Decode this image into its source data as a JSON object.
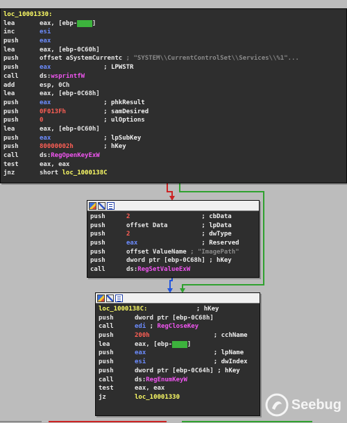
{
  "block1": {
    "lines": [
      {
        "type": "label",
        "text": "loc_10001330:"
      },
      {
        "mn": "lea",
        "parts": [
          {
            "t": "eax, [ebp-",
            "c": "plain"
          },
          {
            "t": "0C8h",
            "c": "hl"
          },
          {
            "t": "]",
            "c": "plain"
          }
        ]
      },
      {
        "mn": "inc",
        "parts": [
          {
            "t": "esi",
            "c": "blue"
          }
        ]
      },
      {
        "mn": "push",
        "parts": [
          {
            "t": "eax",
            "c": "blue"
          }
        ]
      },
      {
        "mn": "lea",
        "parts": [
          {
            "t": "eax, [ebp-0C60h]",
            "c": "plain"
          }
        ]
      },
      {
        "mn": "push",
        "parts": [
          {
            "t": "offset aSystemCurrentc",
            "c": "plain"
          },
          {
            "t": " ; \"SYSTEM\\\\CurrentControlSet\\\\Services\\\\%1\"...",
            "c": "gray"
          }
        ]
      },
      {
        "mn": "push",
        "parts": [
          {
            "t": "eax",
            "c": "blue"
          },
          {
            "t": "              ; LPWSTR",
            "c": "white"
          }
        ]
      },
      {
        "mn": "call",
        "parts": [
          {
            "t": "ds:",
            "c": "plain"
          },
          {
            "t": "wsprintfW",
            "c": "magenta"
          }
        ]
      },
      {
        "mn": "add",
        "parts": [
          {
            "t": "esp, 0Ch",
            "c": "plain"
          }
        ]
      },
      {
        "mn": "lea",
        "parts": [
          {
            "t": "eax, [ebp-0C68h]",
            "c": "plain"
          }
        ]
      },
      {
        "mn": "push",
        "parts": [
          {
            "t": "eax",
            "c": "blue"
          },
          {
            "t": "              ; phkResult",
            "c": "white"
          }
        ]
      },
      {
        "mn": "push",
        "parts": [
          {
            "t": "0F013Fh",
            "c": "red"
          },
          {
            "t": "          ; samDesired",
            "c": "white"
          }
        ]
      },
      {
        "mn": "push",
        "parts": [
          {
            "t": "0",
            "c": "red"
          },
          {
            "t": "                ; ulOptions",
            "c": "white"
          }
        ]
      },
      {
        "mn": "lea",
        "parts": [
          {
            "t": "eax, [ebp-0C60h]",
            "c": "plain"
          }
        ]
      },
      {
        "mn": "push",
        "parts": [
          {
            "t": "eax",
            "c": "blue"
          },
          {
            "t": "              ; lpSubKey",
            "c": "white"
          }
        ]
      },
      {
        "mn": "push",
        "parts": [
          {
            "t": "80000002h",
            "c": "red"
          },
          {
            "t": "        ; hKey",
            "c": "white"
          }
        ]
      },
      {
        "mn": "call",
        "parts": [
          {
            "t": "ds:",
            "c": "plain"
          },
          {
            "t": "RegOpenKeyExW",
            "c": "magenta"
          }
        ]
      },
      {
        "mn": "test",
        "parts": [
          {
            "t": "eax, eax",
            "c": "plain"
          }
        ]
      },
      {
        "mn": "jnz",
        "parts": [
          {
            "t": "short ",
            "c": "plain"
          },
          {
            "t": "loc_1000138C",
            "c": "yellow"
          }
        ]
      }
    ]
  },
  "block2": {
    "lines": [
      {
        "mn": "push",
        "parts": [
          {
            "t": "2",
            "c": "red"
          },
          {
            "t": "                   ; cbData",
            "c": "white"
          }
        ]
      },
      {
        "mn": "push",
        "parts": [
          {
            "t": "offset Data",
            "c": "plain"
          },
          {
            "t": "         ; lpData",
            "c": "white"
          }
        ]
      },
      {
        "mn": "push",
        "parts": [
          {
            "t": "2",
            "c": "red"
          },
          {
            "t": "                   ; dwType",
            "c": "white"
          }
        ]
      },
      {
        "mn": "push",
        "parts": [
          {
            "t": "eax",
            "c": "blue"
          },
          {
            "t": "                 ; Reserved",
            "c": "white"
          }
        ]
      },
      {
        "mn": "push",
        "parts": [
          {
            "t": "offset ValueName",
            "c": "plain"
          },
          {
            "t": " ; \"ImagePath\"",
            "c": "gray"
          }
        ]
      },
      {
        "mn": "push",
        "parts": [
          {
            "t": "dword ptr [ebp-0C68h]",
            "c": "plain"
          },
          {
            "t": " ; hKey",
            "c": "white"
          }
        ]
      },
      {
        "mn": "call",
        "parts": [
          {
            "t": "ds:",
            "c": "plain"
          },
          {
            "t": "RegSetValueExW",
            "c": "magenta"
          }
        ]
      }
    ]
  },
  "block3": {
    "lines": [
      {
        "type": "label",
        "text": "loc_1000138C:",
        "comment": "             ; hKey"
      },
      {
        "mn": "push",
        "parts": [
          {
            "t": "dword ptr [ebp-0C68h]",
            "c": "plain"
          }
        ]
      },
      {
        "mn": "call",
        "parts": [
          {
            "t": "edi",
            "c": "blue"
          },
          {
            "t": " ; ",
            "c": "white"
          },
          {
            "t": "RegCloseKey",
            "c": "magenta"
          }
        ]
      },
      {
        "mn": "push",
        "parts": [
          {
            "t": "200h",
            "c": "red"
          },
          {
            "t": "                 ; cchName",
            "c": "white"
          }
        ]
      },
      {
        "mn": "lea",
        "parts": [
          {
            "t": "eax, [ebp-",
            "c": "plain"
          },
          {
            "t": "0C8h",
            "c": "hl"
          },
          {
            "t": "]",
            "c": "plain"
          }
        ]
      },
      {
        "mn": "push",
        "parts": [
          {
            "t": "eax",
            "c": "blue"
          },
          {
            "t": "                  ; lpName",
            "c": "white"
          }
        ]
      },
      {
        "mn": "push",
        "parts": [
          {
            "t": "esi",
            "c": "blue"
          },
          {
            "t": "                  ; dwIndex",
            "c": "white"
          }
        ]
      },
      {
        "mn": "push",
        "parts": [
          {
            "t": "dword ptr [ebp-0C64h]",
            "c": "plain"
          },
          {
            "t": " ; hKey",
            "c": "white"
          }
        ]
      },
      {
        "mn": "call",
        "parts": [
          {
            "t": "ds:",
            "c": "plain"
          },
          {
            "t": "RegEnumKeyW",
            "c": "magenta"
          }
        ]
      },
      {
        "mn": "test",
        "parts": [
          {
            "t": "eax, eax",
            "c": "plain"
          }
        ]
      },
      {
        "mn": "jz",
        "parts": [
          {
            "t": "loc_10001330",
            "c": "yellow"
          }
        ]
      }
    ]
  },
  "watermark": {
    "text": "Seebug"
  },
  "colors": {
    "true_edge": "#2fa12f",
    "false_edge": "#cc2222",
    "jump_edge": "#2255dd"
  }
}
